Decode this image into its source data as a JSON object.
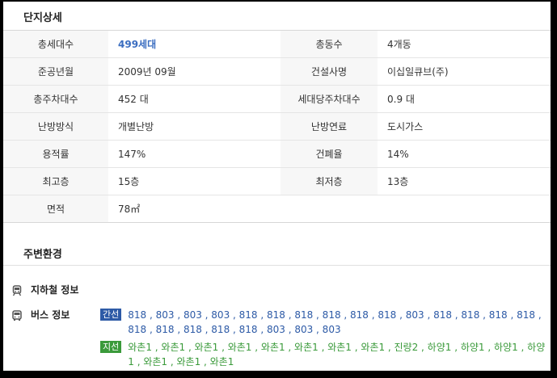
{
  "sections": {
    "detail_title": "단지상세",
    "env_title": "주변환경"
  },
  "details": [
    {
      "label1": "총세대수",
      "value1": "499세대",
      "label2": "총동수",
      "value2": "4개동"
    },
    {
      "label1": "준공년월",
      "value1": "2009년 09월",
      "label2": "건설사명",
      "value2": "이십일큐브(주)"
    },
    {
      "label1": "총주차대수",
      "value1": "452 대",
      "label2": "세대당주차대수",
      "value2": "0.9 대"
    },
    {
      "label1": "난방방식",
      "value1": "개별난방",
      "label2": "난방연료",
      "value2": "도시가스"
    },
    {
      "label1": "용적률",
      "value1": "147%",
      "label2": "건폐율",
      "value2": "14%"
    },
    {
      "label1": "최고층",
      "value1": "15층",
      "label2": "최저층",
      "value2": "13층"
    },
    {
      "label1": "면적",
      "value1": "78㎡"
    }
  ],
  "environment": {
    "subway_label": "지하철 정보",
    "bus_label": "버스 정보",
    "bus_lines": [
      {
        "tag": "간선",
        "routes": "818 , 803 , 803 , 803 , 818 , 818 , 818 , 818 , 818 , 818 , 803 , 818 , 818 , 818 , 818 , 818 , 818 , 818 , 818 , 818 , 803 , 803 , 803"
      },
      {
        "tag": "지선",
        "routes": "와촌1 , 와촌1 , 와촌1 , 와촌1 , 와촌1 , 와촌1 , 와촌1 , 와촌1 , 진량2 , 하양1 , 하양1 , 하양1 , 하양1 , 와촌1 , 와촌1 , 와촌1"
      }
    ]
  },
  "colors": {
    "trunk_tag": "#2d5aa6",
    "branch_tag": "#3a9a3a"
  }
}
